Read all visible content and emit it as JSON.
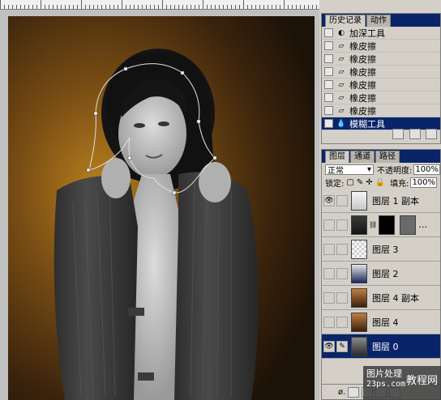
{
  "history_panel": {
    "tabs": [
      {
        "label": "历史记录",
        "active": true
      },
      {
        "label": "动作",
        "active": false
      }
    ],
    "items": [
      {
        "label": "加深工具",
        "icon": "burn-icon",
        "selected": false
      },
      {
        "label": "橡皮擦",
        "icon": "eraser-icon",
        "selected": false
      },
      {
        "label": "橡皮擦",
        "icon": "eraser-icon",
        "selected": false
      },
      {
        "label": "橡皮擦",
        "icon": "eraser-icon",
        "selected": false
      },
      {
        "label": "橡皮擦",
        "icon": "eraser-icon",
        "selected": false
      },
      {
        "label": "橡皮擦",
        "icon": "eraser-icon",
        "selected": false
      },
      {
        "label": "橡皮擦",
        "icon": "eraser-icon",
        "selected": false
      },
      {
        "label": "模糊工具",
        "icon": "blur-icon",
        "selected": true
      }
    ]
  },
  "layers_panel": {
    "tabs": [
      {
        "label": "图层",
        "active": true
      },
      {
        "label": "通道",
        "active": false
      },
      {
        "label": "路径",
        "active": false
      }
    ],
    "blend_mode": "正常",
    "opacity_label": "不透明度:",
    "opacity_value": "100%",
    "lock_label": "锁定:",
    "fill_label": "填充:",
    "fill_value": "100%",
    "layers": [
      {
        "name": "图层 1 副本",
        "visible": true,
        "thumb": "portrait-light",
        "selected": false,
        "mask": false
      },
      {
        "name": "",
        "visible": false,
        "thumb": "portrait-dark",
        "selected": false,
        "mask": true
      },
      {
        "name": "图层 3",
        "visible": false,
        "thumb": "transparent",
        "selected": false,
        "mask": false
      },
      {
        "name": "图层 2",
        "visible": false,
        "thumb": "portrait-blue",
        "selected": false,
        "mask": false
      },
      {
        "name": "图层 4 副本",
        "visible": false,
        "thumb": "portrait-brown",
        "selected": false,
        "mask": false
      },
      {
        "name": "图层 4",
        "visible": false,
        "thumb": "portrait-brown",
        "selected": false,
        "mask": false
      },
      {
        "name": "图层 0",
        "visible": true,
        "thumb": "portrait-gray",
        "selected": true,
        "mask": false
      }
    ]
  },
  "watermark": {
    "line1": "图片处理",
    "line2": "23ps.com",
    "line3": "教程网"
  }
}
